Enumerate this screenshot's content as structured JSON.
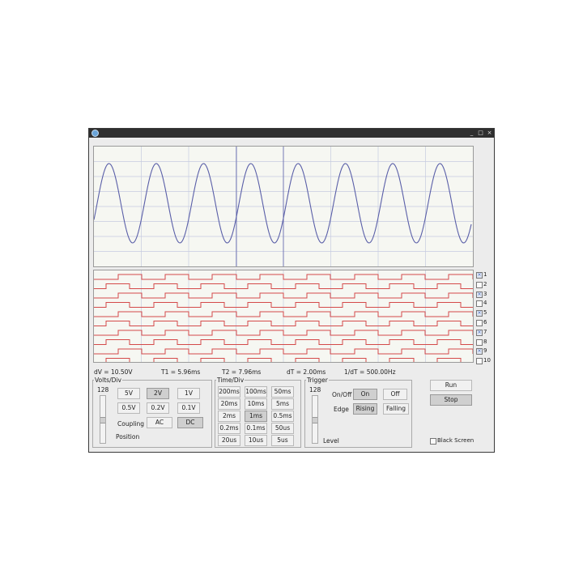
{
  "window": {
    "controls": [
      "_",
      "□",
      "×"
    ]
  },
  "scope": {
    "trace_color": "#5a5fa8",
    "grid_color": "#c6cbe0"
  },
  "logic": {
    "trace_color": "#d44a4a",
    "channels": [
      {
        "label": "1",
        "checked": true
      },
      {
        "label": "2",
        "checked": false
      },
      {
        "label": "3",
        "checked": true
      },
      {
        "label": "4",
        "checked": false
      },
      {
        "label": "5",
        "checked": true
      },
      {
        "label": "6",
        "checked": false
      },
      {
        "label": "7",
        "checked": true
      },
      {
        "label": "8",
        "checked": false
      },
      {
        "label": "9",
        "checked": true
      },
      {
        "label": "10",
        "checked": false
      }
    ]
  },
  "measurements": {
    "dv": "dV = 10.50V",
    "t1": "T1 = 5.96ms",
    "t2": "T2 = 7.96ms",
    "dt": "dT = 2.00ms",
    "freq": "1/dT = 500.00Hz"
  },
  "volts": {
    "legend": "Volts/Div",
    "slider_value": "128",
    "buttons": [
      "5V",
      "2V",
      "1V",
      "0.5V",
      "0.2V",
      "0.1V"
    ],
    "selected": "2V",
    "coupling_label": "Coupling",
    "ac": "AC",
    "dc": "DC",
    "coupling_selected": "DC",
    "position_label": "Position"
  },
  "time": {
    "legend": "Time/Div",
    "buttons": [
      "200ms",
      "100ms",
      "50ms",
      "20ms",
      "10ms",
      "5ms",
      "2ms",
      "1ms",
      "0.5ms",
      "0.2ms",
      "0.1ms",
      "50us",
      "20us",
      "10us",
      "5us"
    ],
    "selected": "1ms"
  },
  "trigger": {
    "legend": "Trigger",
    "slider_value": "128",
    "onoff_label": "On/Off",
    "on": "On",
    "off": "Off",
    "onoff_selected": "On",
    "edge_label": "Edge",
    "rising": "Rising",
    "falling": "Falling",
    "edge_selected": "Rising",
    "level_label": "Level"
  },
  "actions": {
    "run": "Run",
    "stop": "Stop",
    "black_screen": "Black Screen",
    "black_screen_checked": false
  }
}
